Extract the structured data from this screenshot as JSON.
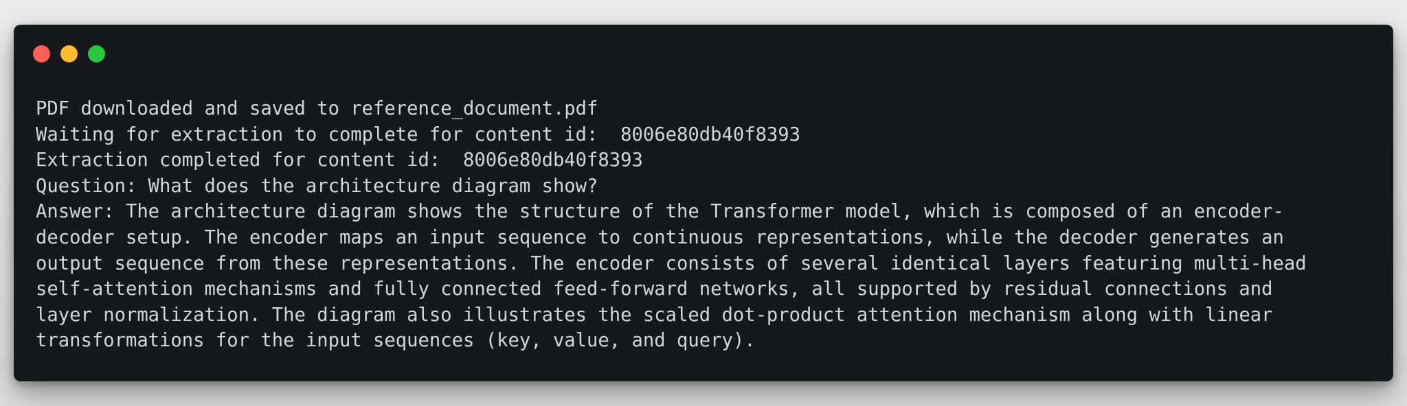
{
  "window": {
    "controls": [
      {
        "name": "close",
        "color": "#fe5f57"
      },
      {
        "name": "minimize",
        "color": "#febc2e"
      },
      {
        "name": "zoom",
        "color": "#28c840"
      }
    ]
  },
  "terminal": {
    "lines": [
      "PDF downloaded and saved to reference_document.pdf",
      "Waiting for extraction to complete for content id:  8006e80db40f8393",
      "Extraction completed for content id:  8006e80db40f8393",
      "Question: What does the architecture diagram show?",
      "Answer: The architecture diagram shows the structure of the Transformer model, which is composed of an encoder-",
      "decoder setup. The encoder maps an input sequence to continuous representations, while the decoder generates an",
      "output sequence from these representations. The encoder consists of several identical layers featuring multi-head",
      "self-attention mechanisms and fully connected feed-forward networks, all supported by residual connections and",
      "layer normalization. The diagram also illustrates the scaled dot-product attention mechanism along with linear",
      "transformations for the input sequences (key, value, and query)."
    ]
  }
}
